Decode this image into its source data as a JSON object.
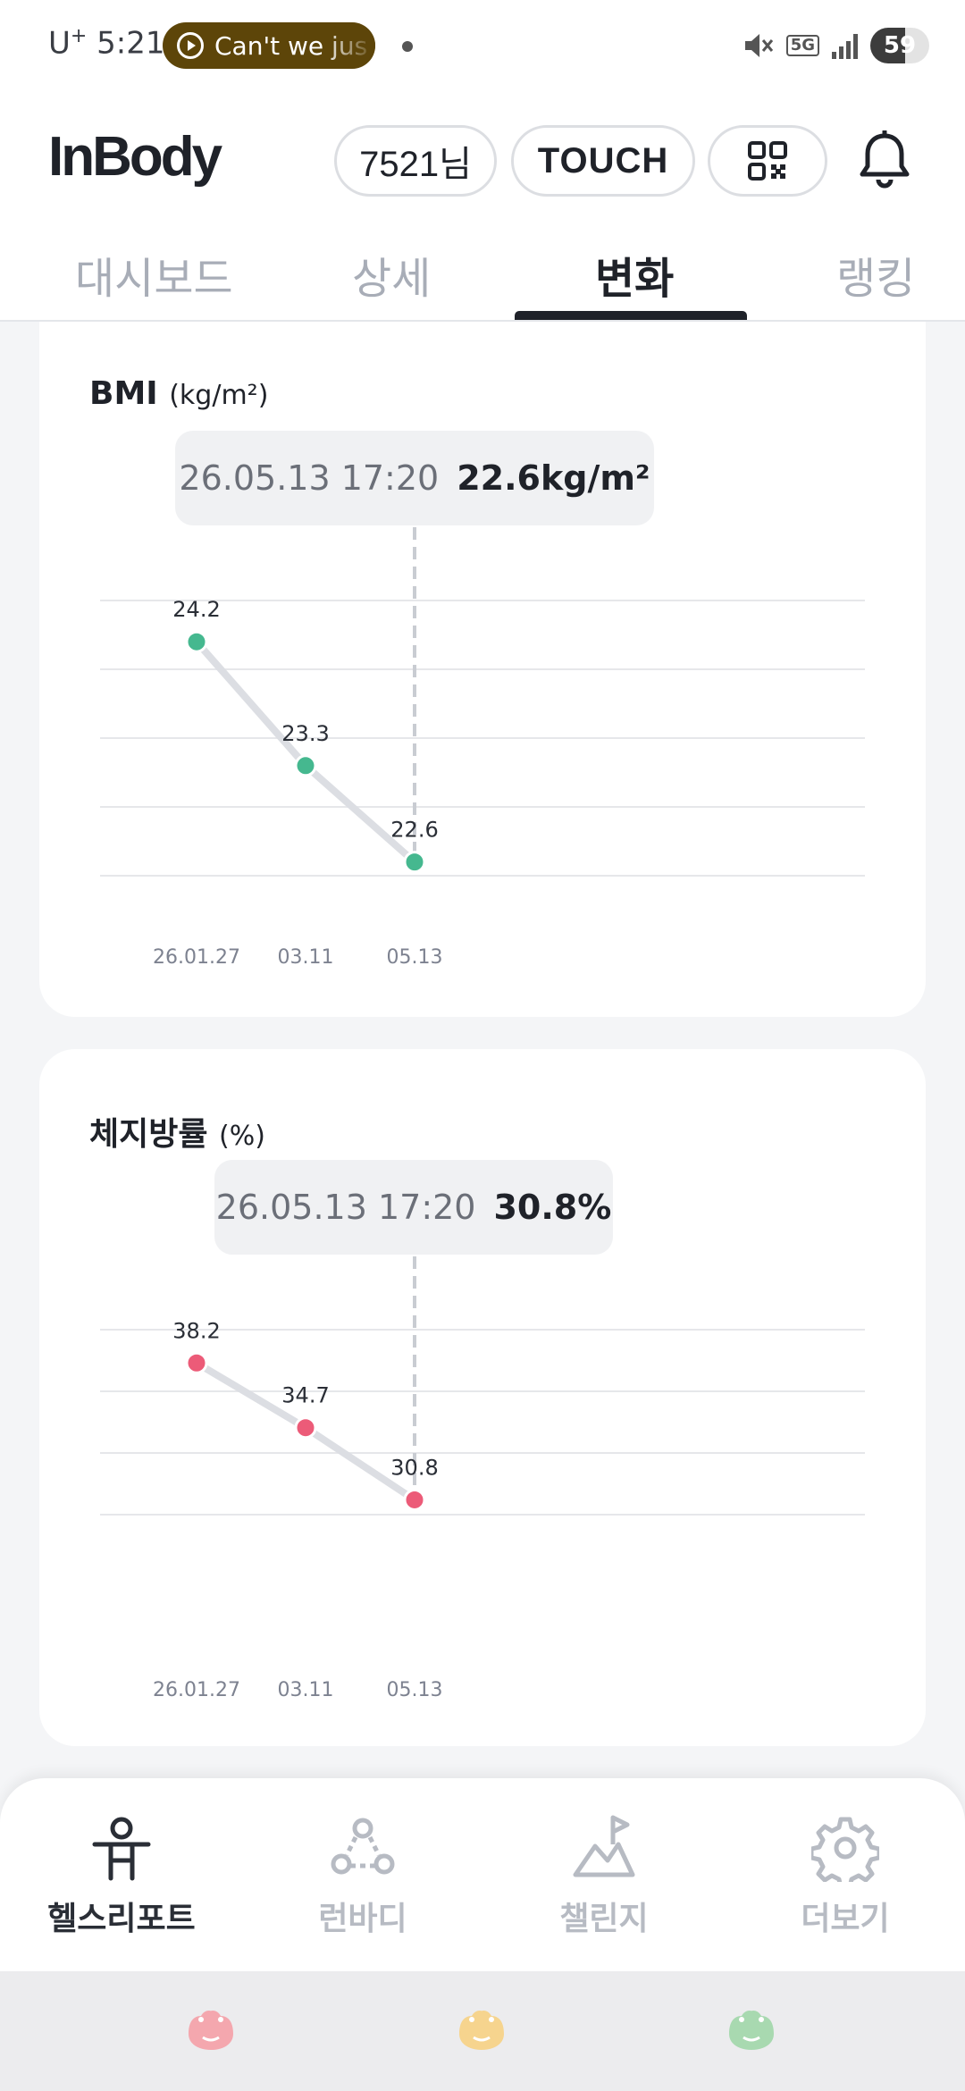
{
  "status_bar": {
    "carrier": "U",
    "carrier_sup": "+",
    "time": "5:21",
    "media_text": "Can't we jus",
    "network": "5G",
    "battery": "59",
    "battery_level": 0.59
  },
  "header": {
    "logo": "InBody",
    "user_button": "7521님",
    "touch_button": "TOUCH",
    "qr_icon": "qr-code-icon",
    "bell_icon": "bell-icon"
  },
  "tabs": [
    {
      "label": "대시보드",
      "active": false
    },
    {
      "label": "상세",
      "active": false
    },
    {
      "label": "변화",
      "active": true
    },
    {
      "label": "랭킹",
      "active": false
    }
  ],
  "bmi_card": {
    "title": "BMI",
    "unit": "(kg/m²)",
    "tooltip_time": "26.05.13 17:20",
    "tooltip_value": "22.6kg/m²",
    "color": "#45b88f"
  },
  "fat_card": {
    "title": "체지방률",
    "unit": "(%)",
    "tooltip_time": "26.05.13 17:20",
    "tooltip_value": "30.8%",
    "color": "#ec5b78"
  },
  "chart_data": [
    {
      "type": "line",
      "title": "BMI",
      "ylabel": "kg/m²",
      "categories": [
        "26.01.27",
        "03.11",
        "05.13"
      ],
      "series": [
        {
          "values": [
            24.2,
            23.3,
            22.6
          ]
        }
      ],
      "ylim": [
        22.5,
        24.5
      ],
      "grid": true,
      "selected_index": 2
    },
    {
      "type": "line",
      "title": "체지방률",
      "ylabel": "%",
      "categories": [
        "26.01.27",
        "03.11",
        "05.13"
      ],
      "series": [
        {
          "values": [
            38.2,
            34.7,
            30.8
          ]
        }
      ],
      "ylim": [
        30.0,
        40.0
      ],
      "grid": true,
      "selected_index": 2
    }
  ],
  "bottom_nav": [
    {
      "label": "헬스리포트",
      "icon": "person-icon",
      "active": true
    },
    {
      "label": "런바디",
      "icon": "community-icon",
      "active": false
    },
    {
      "label": "챌린지",
      "icon": "challenge-flag-icon",
      "active": false
    },
    {
      "label": "더보기",
      "icon": "gear-icon",
      "active": false
    }
  ],
  "system_bar": {
    "colors": [
      "#f4a7ae",
      "#f6d48e",
      "#a8d9b0"
    ]
  }
}
